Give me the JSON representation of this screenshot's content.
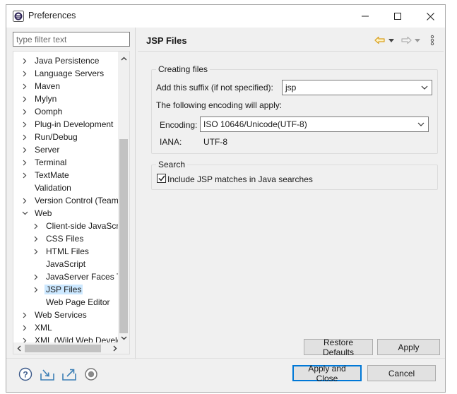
{
  "window": {
    "title": "Preferences"
  },
  "filter": {
    "placeholder": "type filter text"
  },
  "tree": [
    {
      "label": "Java Persistence",
      "depth": 0,
      "chevron": "right"
    },
    {
      "label": "Language Servers",
      "depth": 0,
      "chevron": "right"
    },
    {
      "label": "Maven",
      "depth": 0,
      "chevron": "right"
    },
    {
      "label": "Mylyn",
      "depth": 0,
      "chevron": "right"
    },
    {
      "label": "Oomph",
      "depth": 0,
      "chevron": "right"
    },
    {
      "label": "Plug-in Development",
      "depth": 0,
      "chevron": "right"
    },
    {
      "label": "Run/Debug",
      "depth": 0,
      "chevron": "right"
    },
    {
      "label": "Server",
      "depth": 0,
      "chevron": "right"
    },
    {
      "label": "Terminal",
      "depth": 0,
      "chevron": "right"
    },
    {
      "label": "TextMate",
      "depth": 0,
      "chevron": "right"
    },
    {
      "label": "Validation",
      "depth": 0,
      "chevron": "none"
    },
    {
      "label": "Version Control (Team)",
      "depth": 0,
      "chevron": "right"
    },
    {
      "label": "Web",
      "depth": 0,
      "chevron": "down"
    },
    {
      "label": "Client-side JavaScript",
      "depth": 1,
      "chevron": "right"
    },
    {
      "label": "CSS Files",
      "depth": 1,
      "chevron": "right"
    },
    {
      "label": "HTML Files",
      "depth": 1,
      "chevron": "right"
    },
    {
      "label": "JavaScript",
      "depth": 1,
      "chevron": "none"
    },
    {
      "label": "JavaServer Faces Tools",
      "depth": 1,
      "chevron": "right"
    },
    {
      "label": "JSP Files",
      "depth": 1,
      "chevron": "right",
      "selected": true
    },
    {
      "label": "Web Page Editor",
      "depth": 1,
      "chevron": "none"
    },
    {
      "label": "Web Services",
      "depth": 0,
      "chevron": "right"
    },
    {
      "label": "XML",
      "depth": 0,
      "chevron": "right"
    },
    {
      "label": "XML (Wild Web Developer)",
      "depth": 0,
      "chevron": "right"
    }
  ],
  "page": {
    "title": "JSP Files",
    "creating_group": {
      "title": "Creating files",
      "suffix_label": "Add this suffix (if not specified):",
      "suffix_value": "jsp",
      "encoding_note": "The following encoding will apply:",
      "encoding_label": "Encoding:",
      "encoding_value": "ISO 10646/Unicode(UTF-8)",
      "iana_label": "IANA:",
      "iana_value": "UTF-8"
    },
    "search_group": {
      "title": "Search",
      "include_label": "Include JSP matches in Java searches",
      "include_checked": true
    },
    "restore_defaults": "Restore Defaults",
    "apply": "Apply"
  },
  "footer": {
    "apply_and_close": "Apply and Close",
    "cancel": "Cancel"
  },
  "colors": {
    "selection": "#cce8ff",
    "accent": "#0078d7",
    "nav_back": "#d9a020"
  }
}
